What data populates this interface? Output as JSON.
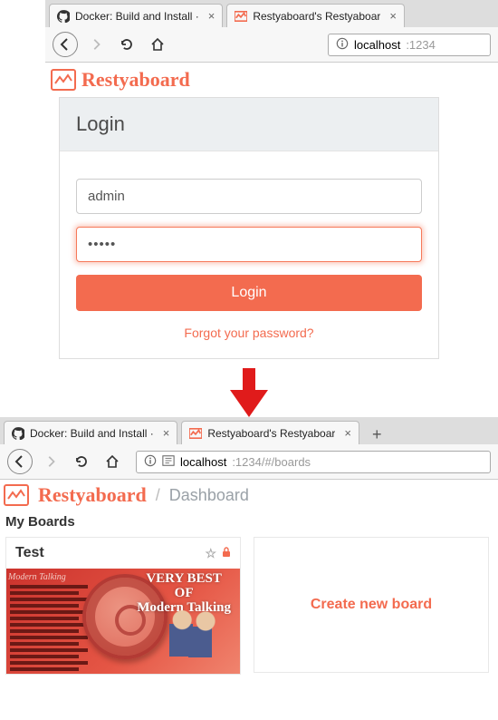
{
  "top": {
    "tabs": [
      {
        "label": "Docker: Build and Install ·",
        "icon": "github"
      },
      {
        "label": "Restyaboard's Restyaboar",
        "icon": "restya"
      }
    ],
    "url": {
      "host": "localhost",
      "port": ":1234"
    },
    "brand": "Restyaboard",
    "login": {
      "title": "Login",
      "username": "admin",
      "password": "•••••",
      "submit": "Login",
      "forgot": "Forgot your password?"
    }
  },
  "bottom": {
    "tabs": [
      {
        "label": "Docker: Build and Install ·",
        "icon": "github"
      },
      {
        "label": "Restyaboard's Restyaboar",
        "icon": "restya"
      }
    ],
    "url": {
      "host": "localhost",
      "rest": ":1234/#/boards"
    },
    "brand": "Restyaboard",
    "breadcrumb": {
      "sep": "/",
      "current": "Dashboard"
    },
    "section": "My Boards",
    "board": {
      "title": "Test",
      "topLeft": "Modern Talking",
      "topRight": "VERY BEST\nOF\nModern Talking"
    },
    "create": "Create new board"
  }
}
